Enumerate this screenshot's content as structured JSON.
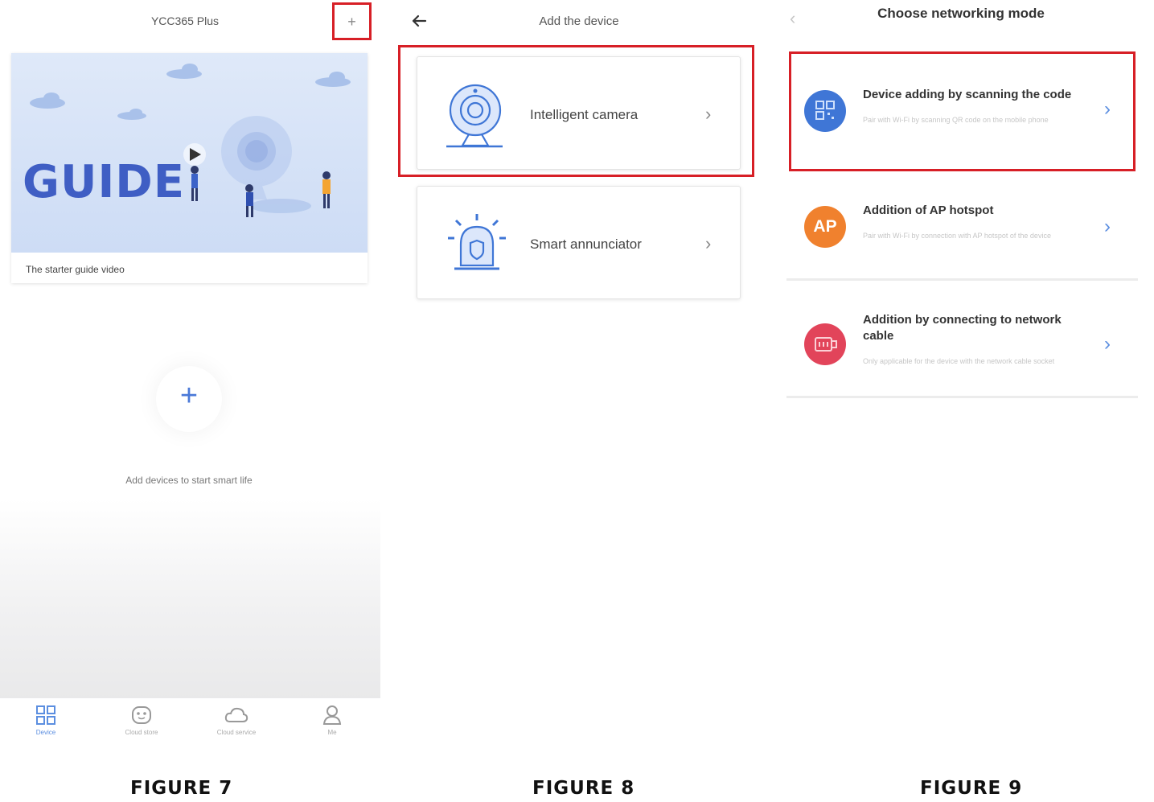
{
  "figure7": {
    "app_title": "YCC365 Plus",
    "add_symbol": "+",
    "guide": {
      "banner_word": "GUIDE",
      "caption": "The starter guide video"
    },
    "empty_state": {
      "plus_symbol": "+",
      "text": "Add devices to start smart life"
    },
    "tabs": [
      {
        "icon": "devices-icon",
        "label": "Device",
        "active": true
      },
      {
        "icon": "robot-face-icon",
        "label": "Cloud store"
      },
      {
        "icon": "cloud-icon",
        "label": "Cloud service"
      },
      {
        "icon": "user-icon",
        "label": "Me"
      }
    ],
    "caption": "FIGURE 7"
  },
  "figure8": {
    "back_icon": "arrow-left-icon",
    "title": "Add the device",
    "devices": [
      {
        "icon": "webcam-icon",
        "label": "Intelligent camera",
        "chevron": "›"
      },
      {
        "icon": "alarm-siren-icon",
        "label": "Smart annunciator",
        "chevron": "›"
      }
    ],
    "caption": "FIGURE 8"
  },
  "figure9": {
    "back_symbol": "‹",
    "title": "Choose networking mode",
    "modes": [
      {
        "icon": "qr-code-icon",
        "color": "#3f76d6",
        "title": "Device adding by scanning the code",
        "description": "Pair with Wi-Fi by scanning QR code on the mobile phone",
        "chevron": "›"
      },
      {
        "icon": "ap-hotspot-icon",
        "icon_text": "AP",
        "color": "#f0812e",
        "title": "Addition of AP hotspot",
        "description": "Pair with Wi-Fi by connection with AP hotspot of the device",
        "chevron": "›"
      },
      {
        "icon": "network-cable-icon",
        "color": "#e2445a",
        "title": "Addition by connecting to network cable",
        "description": "Only applicable for the device with the network cable socket",
        "chevron": "›"
      }
    ],
    "caption": "FIGURE 9"
  }
}
